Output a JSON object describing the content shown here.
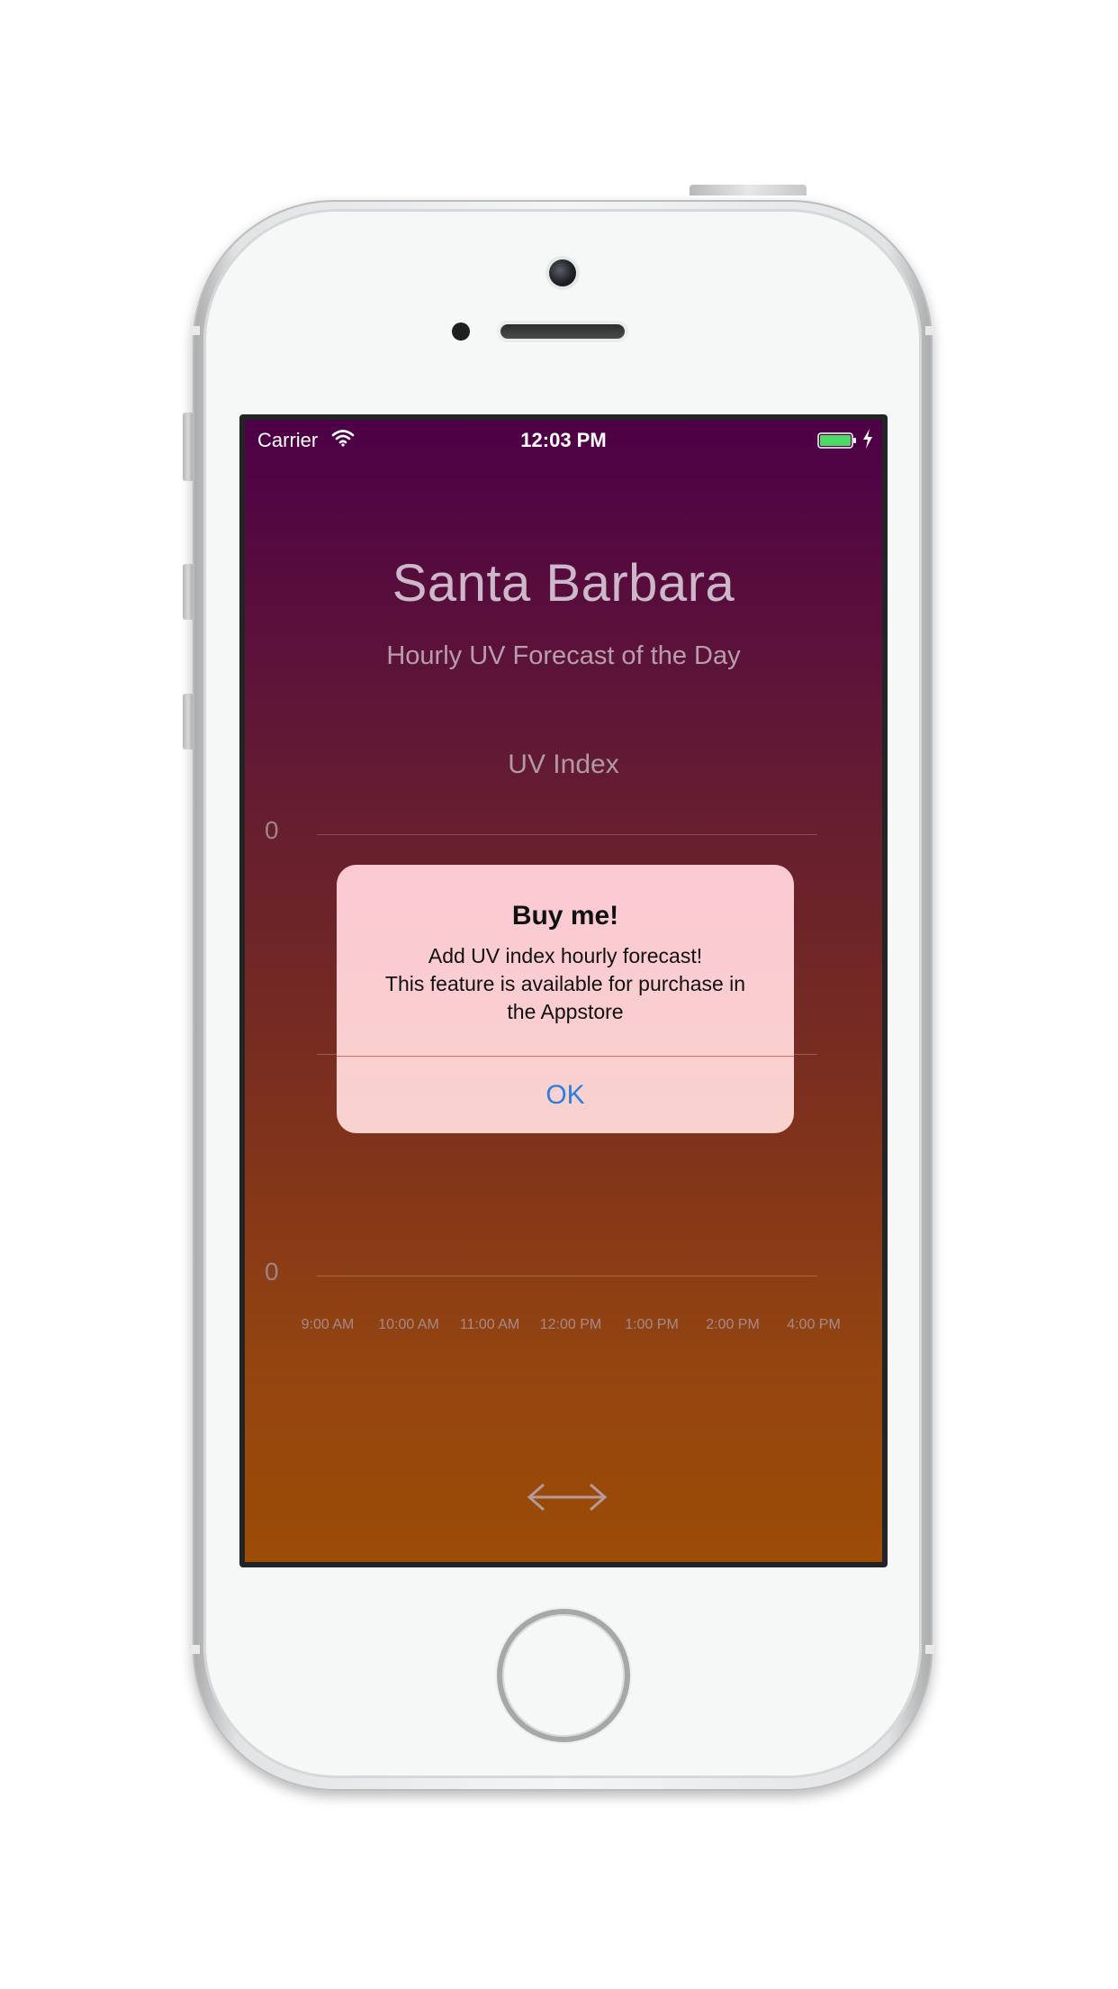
{
  "status_bar": {
    "carrier": "Carrier",
    "time": "12:03 PM"
  },
  "app": {
    "city": "Santa Barbara",
    "subtitle": "Hourly UV Forecast of the Day",
    "chart_title": "UV Index"
  },
  "chart_data": {
    "type": "line",
    "title": "UV Index",
    "x": [
      "9:00 AM",
      "10:00 AM",
      "11:00 AM",
      "12:00 PM",
      "1:00 PM",
      "2:00 PM",
      "4:00 PM"
    ],
    "y_tick_labels": [
      "0",
      "0"
    ],
    "series": [],
    "grid": true
  },
  "alert": {
    "title": "Buy me!",
    "message_lines": [
      "Add UV index hourly forecast!",
      "This feature is available for purchase in",
      "the  Appstore"
    ],
    "ok_label": "OK"
  },
  "icons": {
    "wifi": "wifi-icon",
    "battery": "battery-icon",
    "charging": "charging-bolt-icon",
    "swap": "swap-arrows-icon"
  },
  "colors": {
    "accent": "#2a7ee0",
    "battery": "#4cd964",
    "gradient_top": "#4d0046",
    "gradient_bottom": "#9c4c05"
  }
}
